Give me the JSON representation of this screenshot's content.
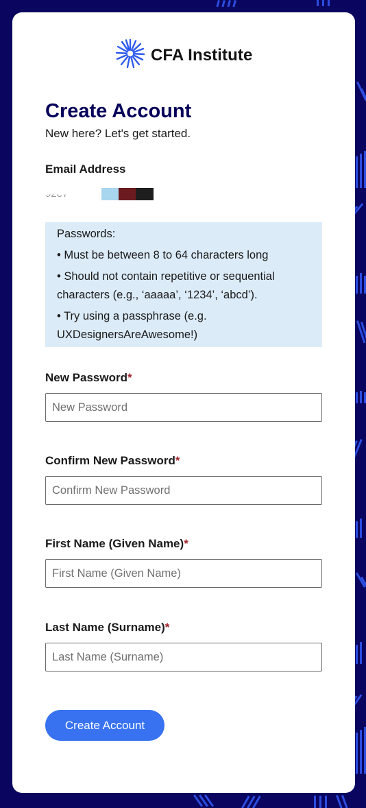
{
  "brand": {
    "name": "CFA Institute",
    "logo_icon": "cfa-starburst-icon",
    "logo_color": "#2e5bef"
  },
  "page": {
    "title": "Create Account",
    "subtitle": "New here? Let's get started."
  },
  "email": {
    "label": "Email Address",
    "value_visible": "92e7"
  },
  "password_rules": {
    "heading": "Passwords:",
    "items": [
      "• Must be between 8 to 64 characters long",
      "• Should not contain repetitive or sequential",
      "characters (e.g., ‘aaaaa’, ‘1234’, ‘abcd’).",
      "• Try using a passphrase (e.g.",
      "UXDesignersAreAwesome!)"
    ]
  },
  "fields": {
    "new_password": {
      "label": "New Password",
      "required_mark": "*",
      "placeholder": "New Password",
      "value": ""
    },
    "confirm_password": {
      "label": "Confirm New Password",
      "required_mark": "*",
      "placeholder": "Confirm New Password",
      "value": ""
    },
    "first_name": {
      "label": "First Name (Given Name)",
      "required_mark": "*",
      "placeholder": "First Name (Given Name)",
      "value": ""
    },
    "last_name": {
      "label": "Last Name (Surname)",
      "required_mark": "*",
      "placeholder": "Last Name (Surname)",
      "value": ""
    }
  },
  "submit": {
    "label": "Create Account"
  },
  "colors": {
    "background": "#0a0660",
    "pattern": "#2f52e6",
    "title": "#06005a",
    "info_box": "#dcebf8",
    "button": "#3872f0",
    "required": "#a1232b"
  }
}
